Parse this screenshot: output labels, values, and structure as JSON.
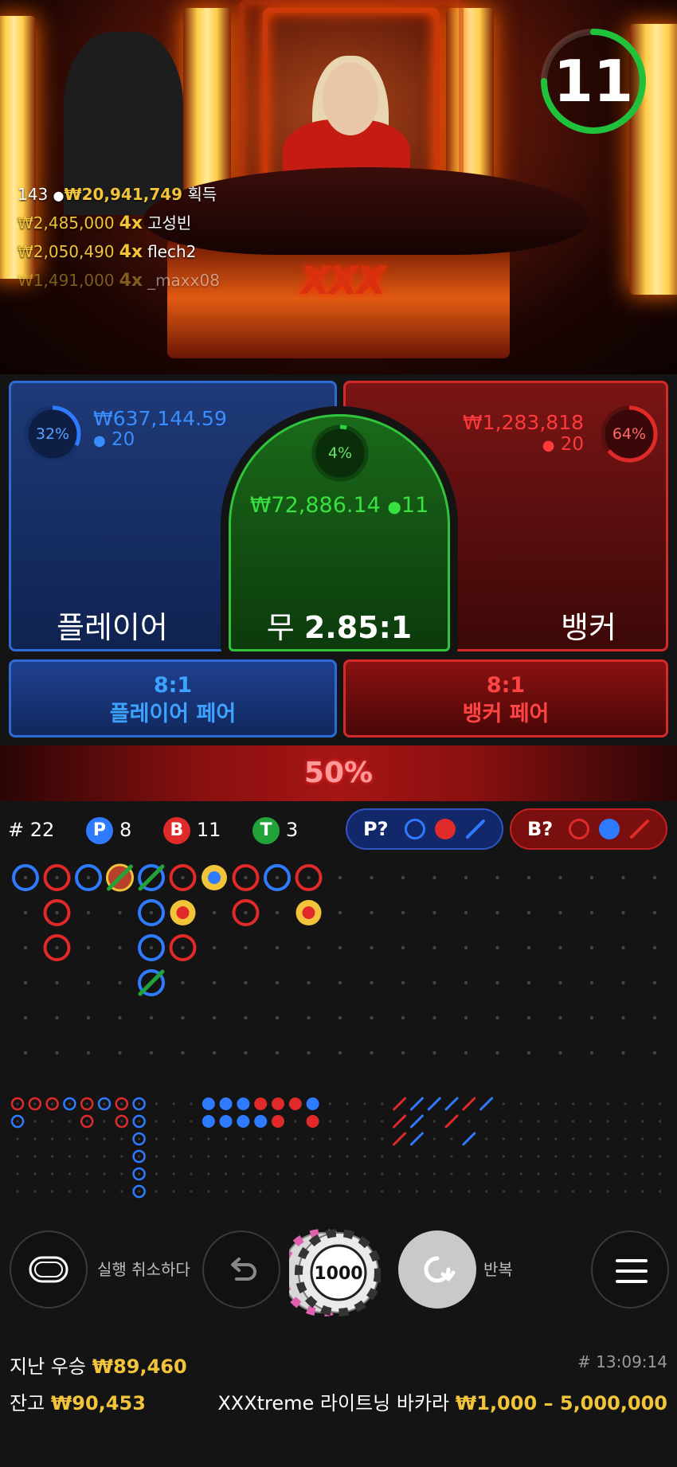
{
  "timer": {
    "seconds": "11",
    "progress": 0.75
  },
  "winners": {
    "count": "143",
    "total_amount": "₩20,941,749",
    "total_suffix": "획득",
    "list": [
      {
        "amount": "₩2,485,000",
        "multiplier": "4x",
        "name": "고성빈"
      },
      {
        "amount": "₩2,050,490",
        "multiplier": "4x",
        "name": "flech2"
      },
      {
        "amount": "₩1,491,000",
        "multiplier": "4x",
        "name": "_maxx08"
      }
    ]
  },
  "video": {
    "logo": "XXX"
  },
  "bets": {
    "player": {
      "percent": "32%",
      "percent_value": 0.32,
      "amount": "₩637,144.59",
      "players": "20",
      "label": "플레이어"
    },
    "tie": {
      "percent": "4%",
      "percent_value": 0.04,
      "amount": "₩72,886.14",
      "players": "11",
      "label_prefix": "무",
      "payout": "2.85:1"
    },
    "banker": {
      "percent": "64%",
      "percent_value": 0.64,
      "amount": "₩1,283,818",
      "players": "20",
      "label": "뱅커"
    },
    "player_pair": {
      "payout": "8:1",
      "label": "플레이어 페어"
    },
    "banker_pair": {
      "payout": "8:1",
      "label": "뱅커 페어"
    }
  },
  "bet_split": {
    "label": "50%"
  },
  "stats": {
    "rounds_prefix": "#",
    "rounds": "22",
    "player_letter": "P",
    "player_count": "8",
    "banker_letter": "B",
    "banker_count": "11",
    "tie_letter": "T",
    "tie_count": "3",
    "predict_player": "P?",
    "predict_banker": "B?"
  },
  "colors": {
    "player": "#2f7bff",
    "banker": "#e02a2a",
    "tie": "#22a33a",
    "gold": "#f2c43a"
  },
  "controls": {
    "table_icon": "table-icon",
    "undo_label": "실행 취소하다",
    "chip_value": "1000",
    "repeat_label": "반복",
    "menu_icon": "menu-icon"
  },
  "footer": {
    "last_win_label": "지난 우승",
    "last_win_amount": "₩89,460",
    "balance_label": "잔고",
    "balance_amount": "₩90,453",
    "round_id": "# 13:09:14",
    "table_name": "XXXtreme 라이트닝 바카라",
    "limits": "₩1,000 – 5,000,000"
  }
}
